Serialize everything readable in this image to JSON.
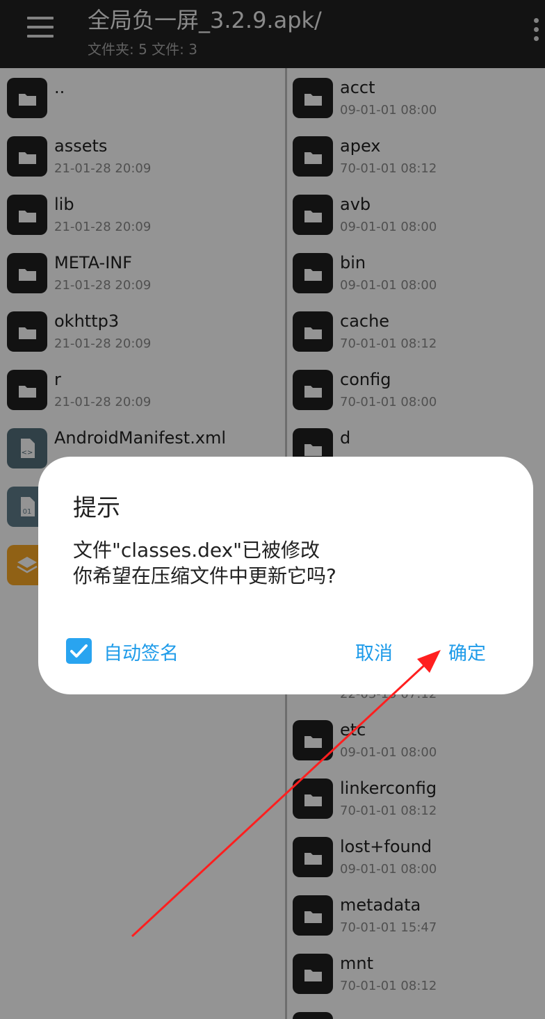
{
  "toolbar": {
    "title": "全局负一屏_3.2.9.apk/",
    "subtitle": "文件夹: 5  文件: 3",
    "menu_icon": "hamburger-menu-icon",
    "more_icon": "more-vert-icon"
  },
  "left_panel": {
    "items": [
      {
        "name": "..",
        "date": "",
        "type": "folder"
      },
      {
        "name": "assets",
        "date": "21-01-28 20:09",
        "type": "folder"
      },
      {
        "name": "lib",
        "date": "21-01-28 20:09",
        "type": "folder"
      },
      {
        "name": "META-INF",
        "date": "21-01-28 20:09",
        "type": "folder"
      },
      {
        "name": "okhttp3",
        "date": "21-01-28 20:09",
        "type": "folder"
      },
      {
        "name": "r",
        "date": "21-01-28 20:09",
        "type": "folder"
      },
      {
        "name": "AndroidManifest.xml",
        "date": "",
        "type": "xml"
      },
      {
        "name": "",
        "date": "",
        "type": "dex"
      },
      {
        "name": "",
        "date": "",
        "type": "arsc"
      }
    ]
  },
  "right_panel": {
    "items": [
      {
        "name": "acct",
        "date": "09-01-01 08:00"
      },
      {
        "name": "apex",
        "date": "70-01-01 08:12"
      },
      {
        "name": "avb",
        "date": "09-01-01 08:00"
      },
      {
        "name": "bin",
        "date": "09-01-01 08:00"
      },
      {
        "name": "cache",
        "date": "70-01-01 08:12"
      },
      {
        "name": "config",
        "date": "70-01-01 08:00"
      },
      {
        "name": "d",
        "date": ""
      },
      {
        "name": "",
        "date": "22-03-15 07:12"
      },
      {
        "name": "etc",
        "date": "09-01-01 08:00"
      },
      {
        "name": "linkerconfig",
        "date": "70-01-01 08:12"
      },
      {
        "name": "lost+found",
        "date": "09-01-01 08:00"
      },
      {
        "name": "metadata",
        "date": "70-01-01 15:47"
      },
      {
        "name": "mnt",
        "date": "70-01-01 08:12"
      }
    ]
  },
  "dialog": {
    "title": "提示",
    "message_line1": "文件\"classes.dex\"已被修改",
    "message_line2": "你希望在压缩文件中更新它吗?",
    "checkbox_label": "自动签名",
    "checkbox_checked": true,
    "cancel_label": "取消",
    "ok_label": "确定",
    "accent_color": "#1e9be9"
  },
  "annotation": {
    "type": "red-arrow",
    "color": "#ff1f1f",
    "points_to": "ok-button"
  }
}
